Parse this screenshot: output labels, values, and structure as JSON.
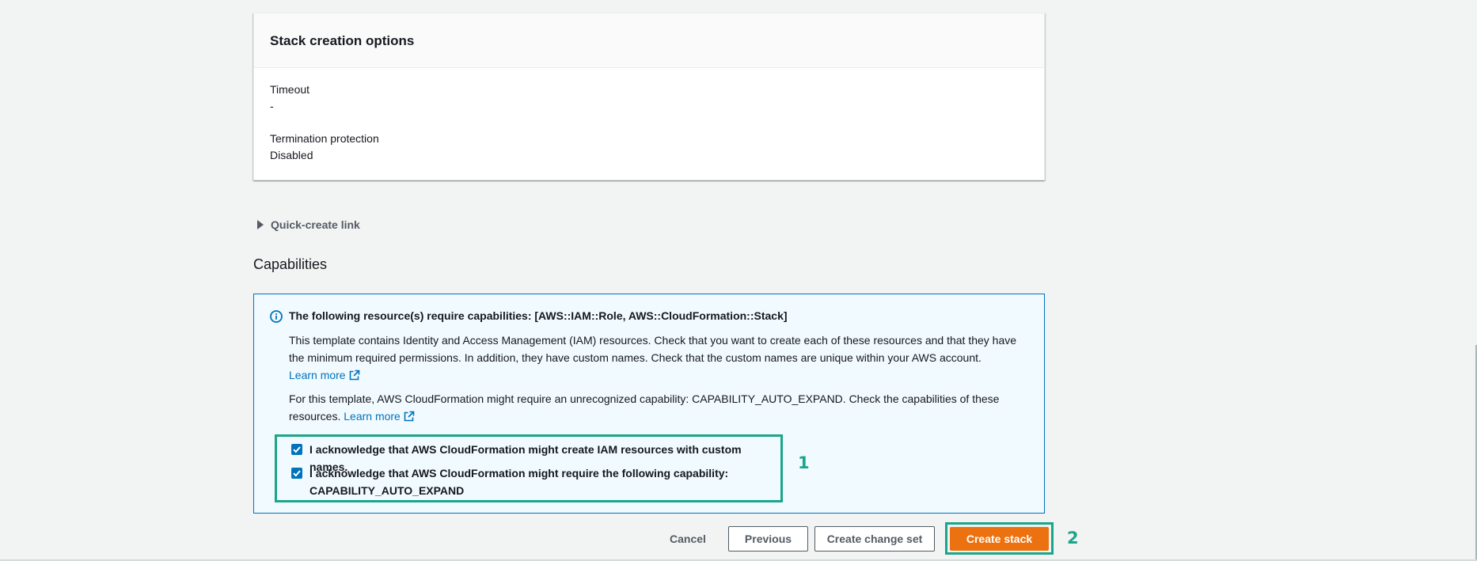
{
  "stack_options": {
    "title": "Stack creation options",
    "timeout_label": "Timeout",
    "timeout_value": "-",
    "termination_label": "Termination protection",
    "termination_value": "Disabled"
  },
  "quick_create": {
    "label": "Quick-create link",
    "icon": "caret-right-icon"
  },
  "capabilities": {
    "heading": "Capabilities",
    "alert": {
      "icon": "info-icon",
      "title": "The following resource(s) require capabilities: [AWS::IAM::Role, AWS::CloudFormation::Stack]",
      "paragraph1": "This template contains Identity and Access Management (IAM) resources. Check that you want to create each of these resources and that they have the minimum required permissions. In addition, they have custom names. Check that the custom names are unique within your AWS account.",
      "paragraph1_link": "Learn more",
      "paragraph2": "For this template, AWS CloudFormation might require an unrecognized capability: CAPABILITY_AUTO_EXPAND. Check the capabilities of these resources.",
      "paragraph2_link": "Learn more"
    },
    "acknowledgements": [
      {
        "label": "I acknowledge that AWS CloudFormation might create IAM resources with custom names.",
        "checked": true
      },
      {
        "label_line1": "I acknowledge that AWS CloudFormation might require the following capability:",
        "label_line2": "CAPABILITY_AUTO_EXPAND",
        "checked": true
      }
    ],
    "marker": "1"
  },
  "actions": {
    "cancel": "Cancel",
    "previous": "Previous",
    "create_change_set": "Create change set",
    "create_stack": "Create stack",
    "marker": "2"
  },
  "colors": {
    "primary": "#ec7211",
    "link": "#0073bb",
    "highlight": "#1aa68a",
    "alert_bg": "#f1faff"
  }
}
